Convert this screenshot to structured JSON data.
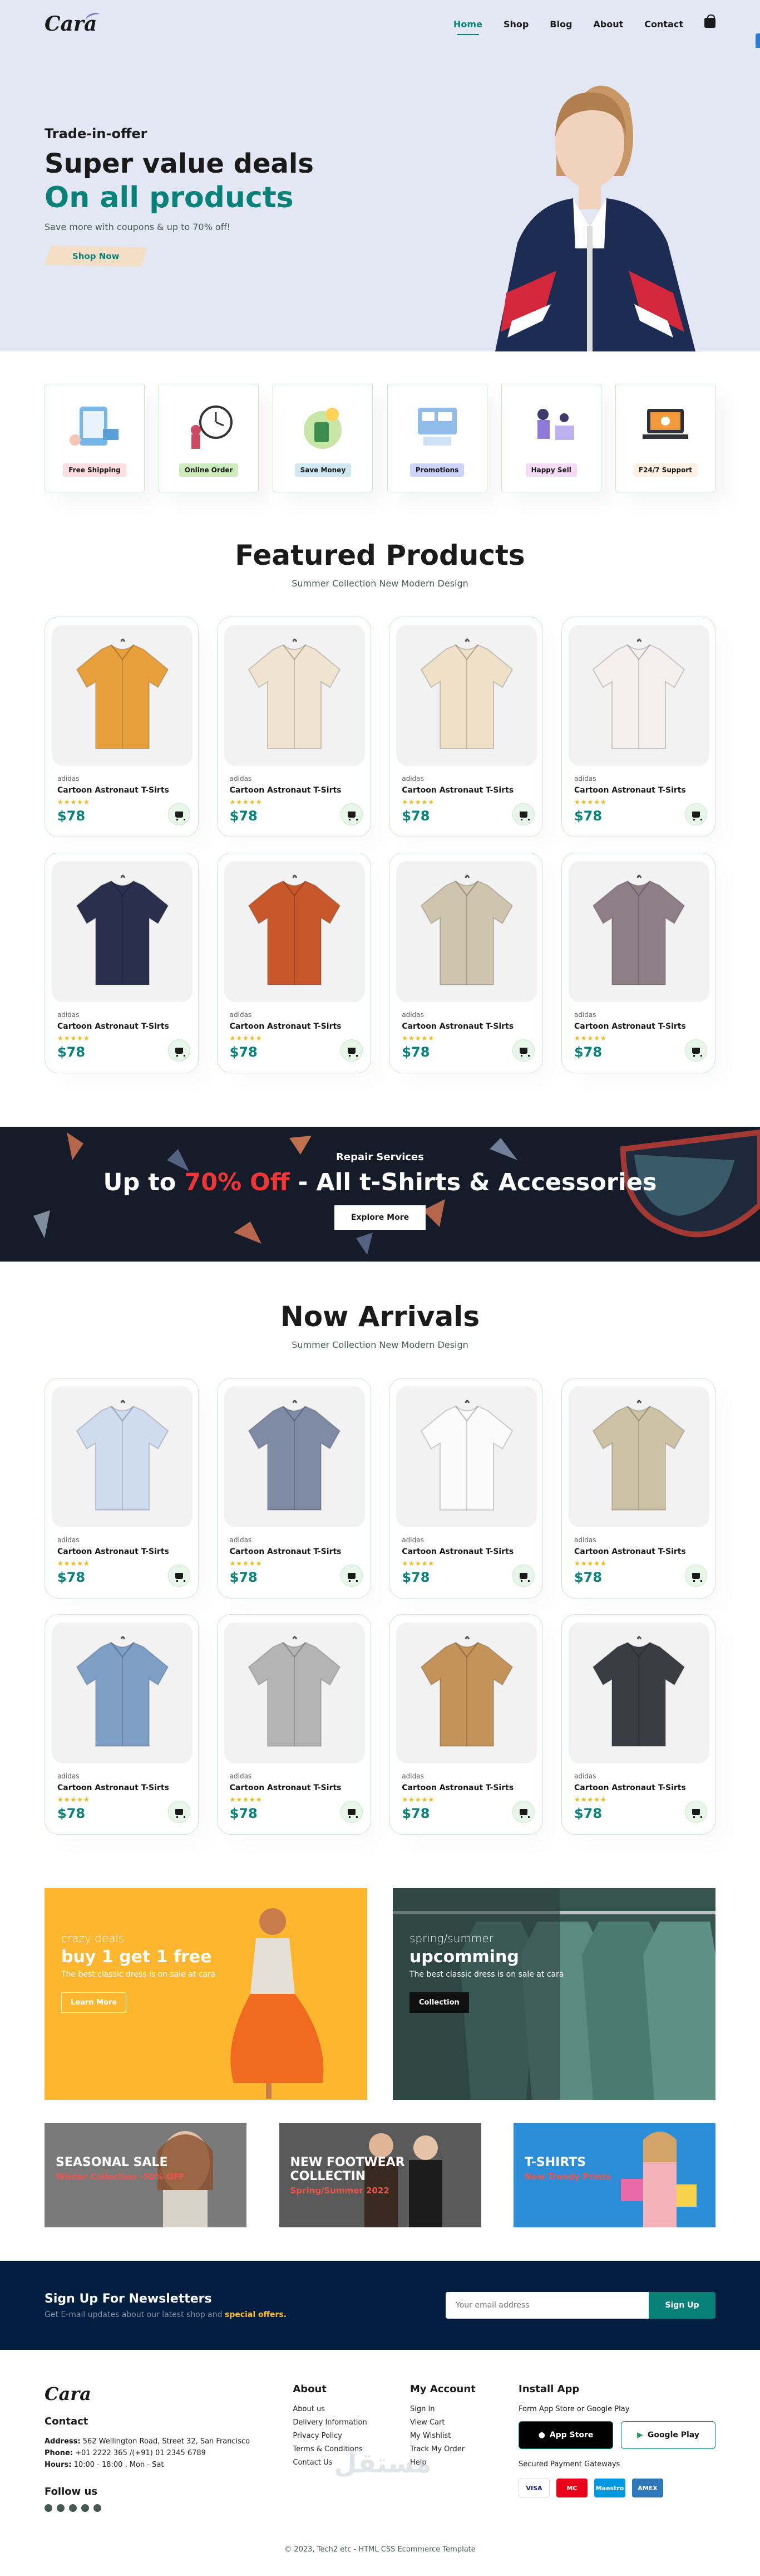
{
  "brand": {
    "name": "Cara"
  },
  "nav": {
    "items": [
      {
        "label": "Home"
      },
      {
        "label": "Shop"
      },
      {
        "label": "Blog"
      },
      {
        "label": "About"
      },
      {
        "label": "Contact"
      }
    ],
    "cart_icon": "bag-icon"
  },
  "hero": {
    "eyebrow": "Trade-in-offer",
    "heading": "Super value deals",
    "highlight": "On all products",
    "text": "Save more with coupons & up to 70% off!",
    "button": "Shop Now"
  },
  "features": [
    {
      "label": "Free Shipping",
      "bg": "#fddde4",
      "icon": "shipping-icon"
    },
    {
      "label": "Online Order",
      "bg": "#cdebbc",
      "icon": "online-order-icon"
    },
    {
      "label": "Save Money",
      "bg": "#d1e8f2",
      "icon": "save-money-icon"
    },
    {
      "label": "Promotions",
      "bg": "#cdd4f8",
      "icon": "promotions-icon"
    },
    {
      "label": "Happy Sell",
      "bg": "#f6dbf6",
      "icon": "happy-sell-icon"
    },
    {
      "label": "F24/7 Support",
      "bg": "#fff2e5",
      "icon": "support-icon"
    }
  ],
  "featured": {
    "title": "Featured Products",
    "subtitle": "Summer Collection New Modern Design",
    "products": [
      {
        "brand": "adidas",
        "name": "Cartoon Astronaut T-Sirts",
        "stars": "★★★★★",
        "price": "$78",
        "color": "#e8a03c"
      },
      {
        "brand": "adidas",
        "name": "Cartoon Astronaut T-Sirts",
        "stars": "★★★★★",
        "price": "$78",
        "color": "#f0e4d0"
      },
      {
        "brand": "adidas",
        "name": "Cartoon Astronaut T-Sirts",
        "stars": "★★★★★",
        "price": "$78",
        "color": "#efe0c8"
      },
      {
        "brand": "adidas",
        "name": "Cartoon Astronaut T-Sirts",
        "stars": "★★★★★",
        "price": "$78",
        "color": "#f6efef"
      },
      {
        "brand": "adidas",
        "name": "Cartoon Astronaut T-Sirts",
        "stars": "★★★★★",
        "price": "$78",
        "color": "#2a2f4e"
      },
      {
        "brand": "adidas",
        "name": "Cartoon Astronaut T-Sirts",
        "stars": "★★★★★",
        "price": "$78",
        "color": "#c8582b"
      },
      {
        "brand": "adidas",
        "name": "Cartoon Astronaut T-Sirts",
        "stars": "★★★★★",
        "price": "$78",
        "color": "#cfc4ad"
      },
      {
        "brand": "adidas",
        "name": "Cartoon Astronaut T-Sirts",
        "stars": "★★★★★",
        "price": "$78",
        "color": "#8e7f86"
      }
    ]
  },
  "banner": {
    "eyebrow": "Repair Services",
    "heading_pre": "Up to",
    "heading_red": "70% Off",
    "heading_post": "- All t-Shirts & Accessories",
    "button": "Explore More"
  },
  "arrivals": {
    "title": "Now Arrivals",
    "subtitle": "Summer Collection New Modern Design",
    "products": [
      {
        "brand": "adidas",
        "name": "Cartoon Astronaut T-Sirts",
        "stars": "★★★★★",
        "price": "$78",
        "color": "#cfdcef"
      },
      {
        "brand": "adidas",
        "name": "Cartoon Astronaut T-Sirts",
        "stars": "★★★★★",
        "price": "$78",
        "color": "#7f8aa5"
      },
      {
        "brand": "adidas",
        "name": "Cartoon Astronaut T-Sirts",
        "stars": "★★★★★",
        "price": "$78",
        "color": "#fbfbfb"
      },
      {
        "brand": "adidas",
        "name": "Cartoon Astronaut T-Sirts",
        "stars": "★★★★★",
        "price": "$78",
        "color": "#cdc2a6"
      },
      {
        "brand": "adidas",
        "name": "Cartoon Astronaut T-Sirts",
        "stars": "★★★★★",
        "price": "$78",
        "color": "#7d9fc6"
      },
      {
        "brand": "adidas",
        "name": "Cartoon Astronaut T-Sirts",
        "stars": "★★★★★",
        "price": "$78",
        "color": "#b4b4b4"
      },
      {
        "brand": "adidas",
        "name": "Cartoon Astronaut T-Sirts",
        "stars": "★★★★★",
        "price": "$78",
        "color": "#c4935a"
      },
      {
        "brand": "adidas",
        "name": "Cartoon Astronaut T-Sirts",
        "stars": "★★★★★",
        "price": "$78",
        "color": "#3b3d45"
      }
    ]
  },
  "promo_left": {
    "eyebrow": "crazy deals",
    "heading": "buy 1 get 1 free",
    "text": "The best classic dress is on sale at cara",
    "button": "Learn More"
  },
  "promo_right": {
    "eyebrow": "spring/summer",
    "heading": "upcomming",
    "text": "The best classic dress is on sale at cara",
    "button": "Collection"
  },
  "promo_three": [
    {
      "heading": "SEASONAL SALE",
      "sub": "Winter Collection -50% OFF"
    },
    {
      "heading": "NEW FOOTWEAR COLLECTIN",
      "sub": "Spring/Summer 2022"
    },
    {
      "heading": "T-SHIRTS",
      "sub": "New Trendy Prints"
    }
  ],
  "newsletter": {
    "title": "Sign Up For Newsletters",
    "text": "Get E-mail updates about our latest shop and",
    "highlight": "special offers.",
    "placeholder": "Your email address",
    "button": "Sign Up"
  },
  "footer": {
    "contact_title": "Contact",
    "address_label": "Address:",
    "address": "562 Wellington Road, Street 32, San Francisco",
    "phone_label": "Phone:",
    "phone": "+01 2222 365 /(+91) 01 2345 6789",
    "hours_label": "Hours:",
    "hours": "10:00 - 18:00 , Mon - Sat",
    "follow_title": "Follow us",
    "about_title": "About",
    "about_links": [
      "About us",
      "Delivery Information",
      "Privacy Policy",
      "Terms & Conditions",
      "Contact Us"
    ],
    "account_title": "My Account",
    "account_links": [
      "Sign In",
      "View Cart",
      "My Wishlist",
      "Track My Order",
      "Help"
    ],
    "install_title": "Install App",
    "install_text": "Form App Store or Google Play",
    "app_store": "App Store",
    "google_play": "Google Play",
    "payment_text": "Secured Payment Gateways",
    "payments": [
      "VISA",
      "MC",
      "Maestro",
      "AMEX"
    ],
    "copyright": "© 2023, Tech2 etc - HTML CSS Ecommerce Template",
    "watermark": "مستقل"
  }
}
